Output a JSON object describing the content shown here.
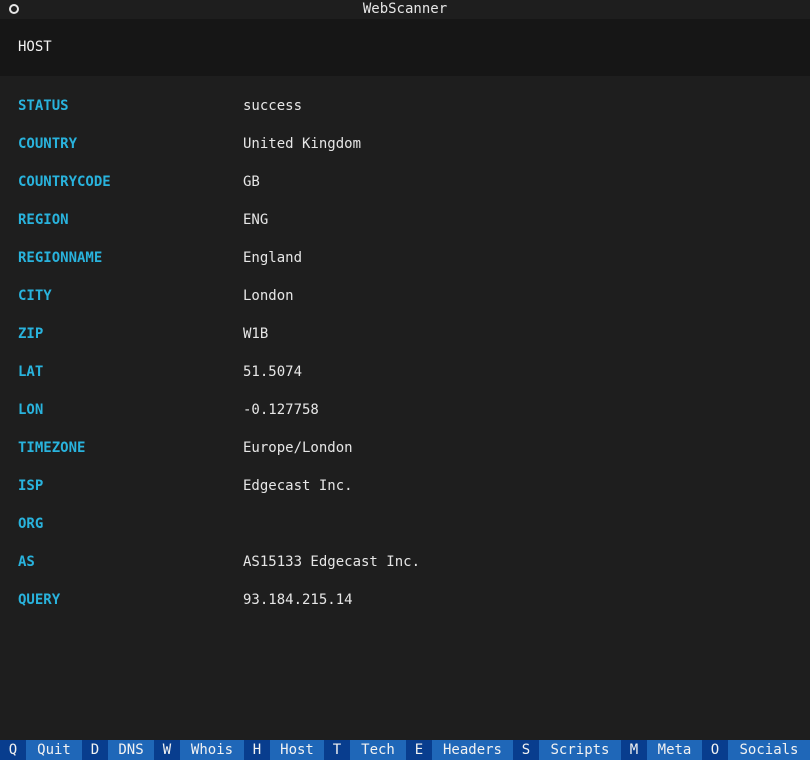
{
  "window": {
    "title": "WebScanner",
    "icon": "circle-icon"
  },
  "header": {
    "title": "HOST"
  },
  "rows": [
    {
      "key": "STATUS",
      "value": "success"
    },
    {
      "key": "COUNTRY",
      "value": "United Kingdom"
    },
    {
      "key": "COUNTRYCODE",
      "value": "GB"
    },
    {
      "key": "REGION",
      "value": "ENG"
    },
    {
      "key": "REGIONNAME",
      "value": "England"
    },
    {
      "key": "CITY",
      "value": "London"
    },
    {
      "key": "ZIP",
      "value": "W1B"
    },
    {
      "key": "LAT",
      "value": "51.5074"
    },
    {
      "key": "LON",
      "value": "-0.127758"
    },
    {
      "key": "TIMEZONE",
      "value": "Europe/London"
    },
    {
      "key": "ISP",
      "value": "Edgecast Inc."
    },
    {
      "key": "ORG",
      "value": ""
    },
    {
      "key": "AS",
      "value": "AS15133 Edgecast Inc."
    },
    {
      "key": "QUERY",
      "value": "93.184.215.14"
    }
  ],
  "footer": {
    "bindings": [
      {
        "key": "Q",
        "label": "Quit"
      },
      {
        "key": "D",
        "label": "DNS"
      },
      {
        "key": "W",
        "label": "Whois"
      },
      {
        "key": "H",
        "label": "Host"
      },
      {
        "key": "T",
        "label": "Tech"
      },
      {
        "key": "E",
        "label": "Headers"
      },
      {
        "key": "S",
        "label": "Scripts"
      },
      {
        "key": "M",
        "label": "Meta"
      },
      {
        "key": "O",
        "label": "Socials"
      }
    ]
  },
  "colors": {
    "background": "#1e1e1e",
    "header_background": "#161616",
    "key_color": "#29b3dd",
    "footer_key_bg": "#083d8e",
    "footer_label_bg": "#1f67b8"
  }
}
